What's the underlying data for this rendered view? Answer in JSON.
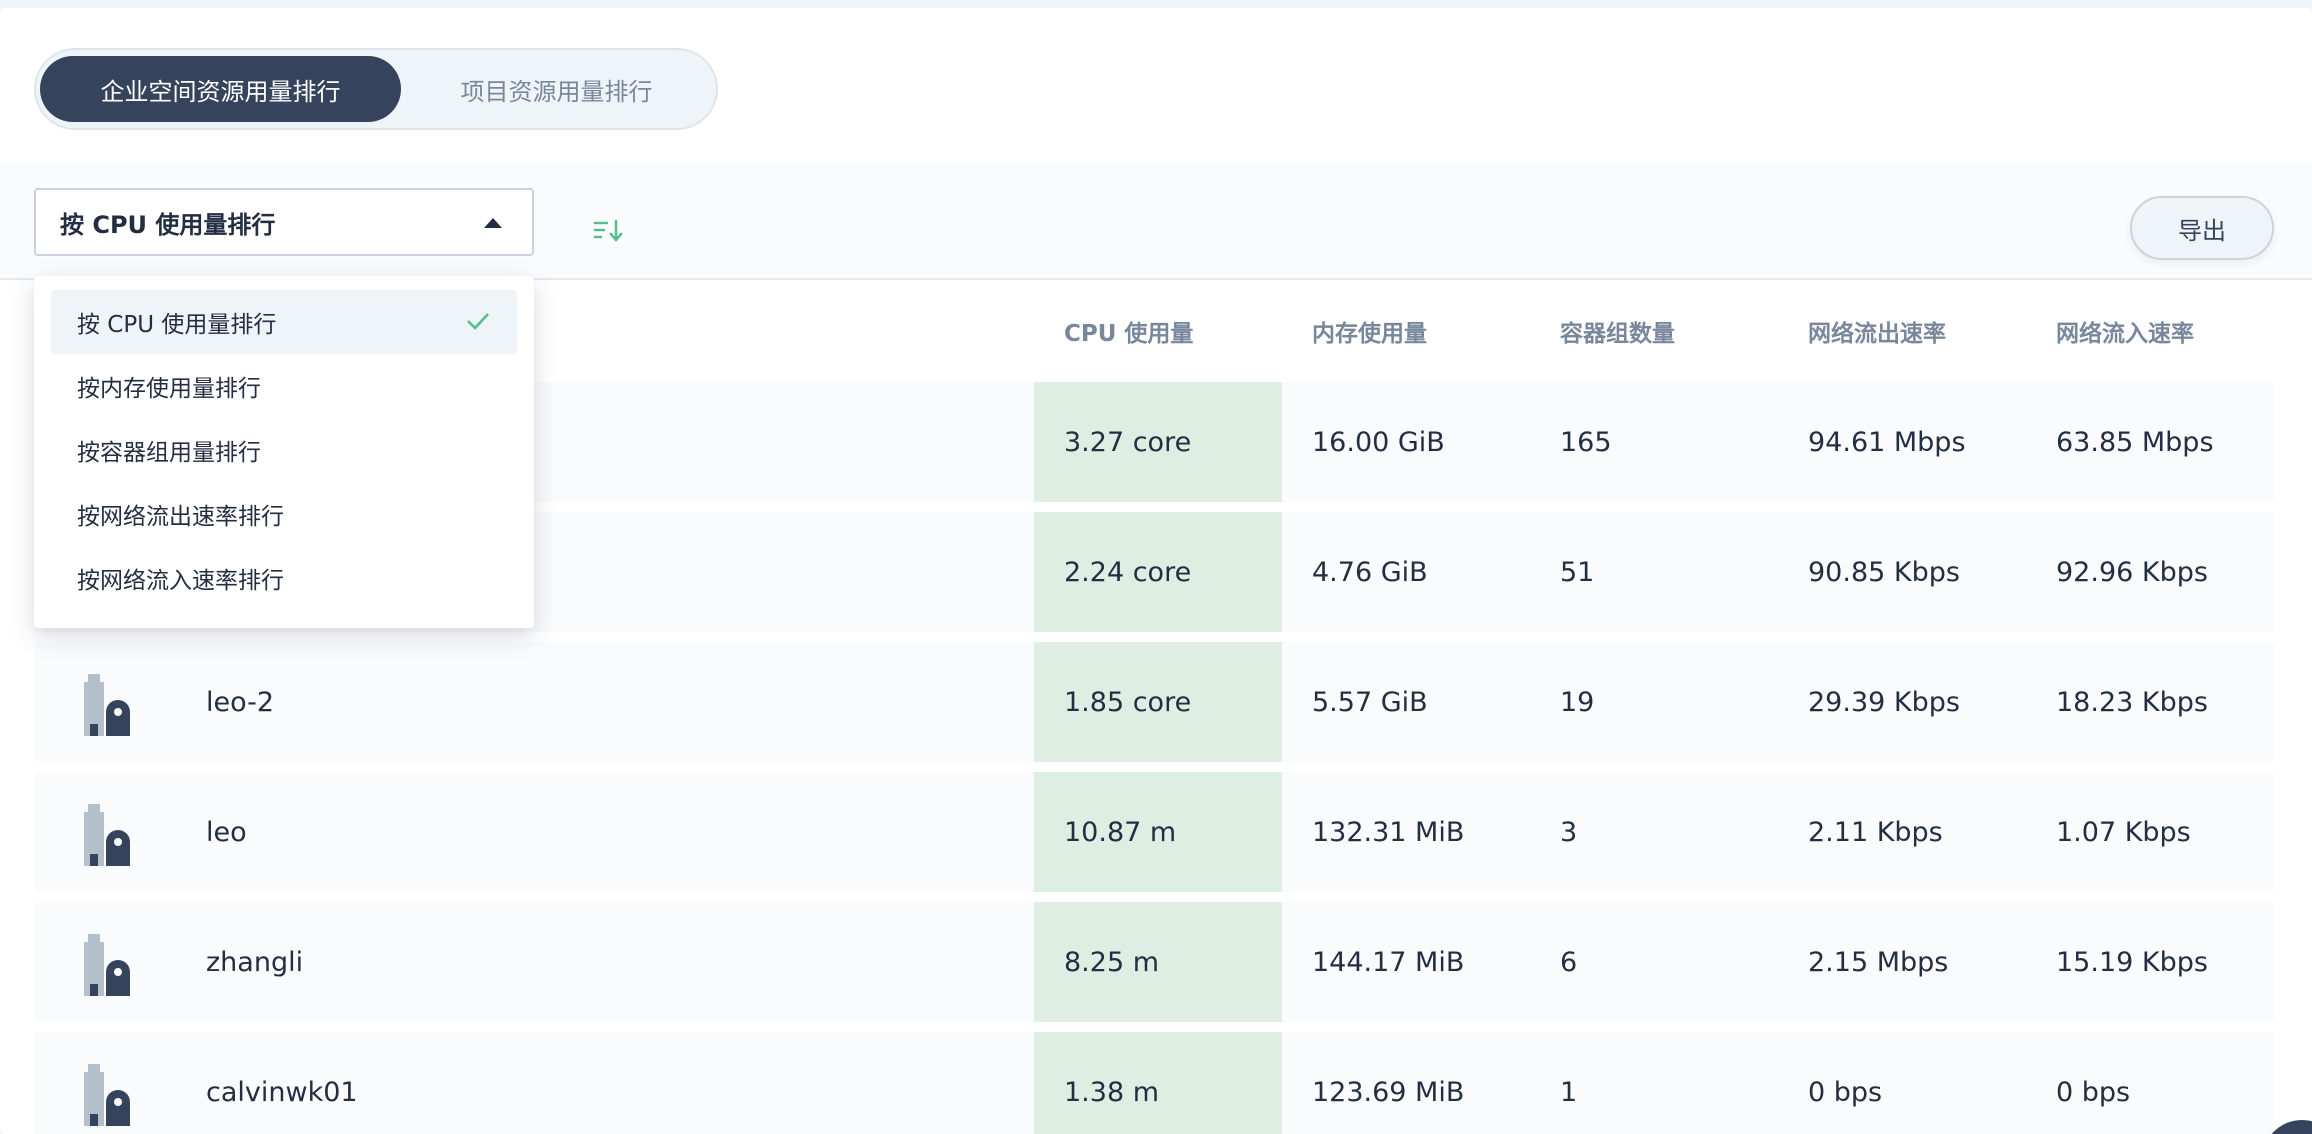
{
  "tabs": [
    {
      "label": "企业空间资源用量排行",
      "active": true
    },
    {
      "label": "项目资源用量排行",
      "active": false
    }
  ],
  "toolbar": {
    "sort_selected": "按 CPU 使用量排行",
    "export_label": "导出",
    "sort_order_icon": "sort-descending-icon"
  },
  "dropdown": {
    "options": [
      {
        "label": "按 CPU 使用量排行",
        "selected": true
      },
      {
        "label": "按内存使用量排行",
        "selected": false
      },
      {
        "label": "按容器组用量排行",
        "selected": false
      },
      {
        "label": "按网络流出速率排行",
        "selected": false
      },
      {
        "label": "按网络流入速率排行",
        "selected": false
      }
    ]
  },
  "table": {
    "headers": {
      "cpu": "CPU 使用量",
      "memory": "内存使用量",
      "pods": "容器组数量",
      "net_out": "网络流出速率",
      "net_in": "网络流入速率"
    },
    "rows": [
      {
        "name": "",
        "cpu": "3.27 core",
        "memory": "16.00 GiB",
        "pods": "165",
        "net_out": "94.61 Mbps",
        "net_in": "63.85 Mbps"
      },
      {
        "name": "",
        "cpu": "2.24 core",
        "memory": "4.76 GiB",
        "pods": "51",
        "net_out": "90.85 Kbps",
        "net_in": "92.96 Kbps"
      },
      {
        "name": "leo-2",
        "cpu": "1.85 core",
        "memory": "5.57 GiB",
        "pods": "19",
        "net_out": "29.39 Kbps",
        "net_in": "18.23 Kbps"
      },
      {
        "name": "leo",
        "cpu": "10.87 m",
        "memory": "132.31 MiB",
        "pods": "3",
        "net_out": "2.11 Kbps",
        "net_in": "1.07 Kbps"
      },
      {
        "name": "zhangli",
        "cpu": "8.25 m",
        "memory": "144.17 MiB",
        "pods": "6",
        "net_out": "2.15 Mbps",
        "net_in": "15.19 Kbps"
      },
      {
        "name": "calvinwk01",
        "cpu": "1.38 m",
        "memory": "123.69 MiB",
        "pods": "1",
        "net_out": "0 bps",
        "net_in": "0 bps"
      }
    ]
  },
  "colors": {
    "accent_dark": "#36435c",
    "cpu_highlight": "#dfeee2",
    "check_green": "#55bc8a"
  }
}
